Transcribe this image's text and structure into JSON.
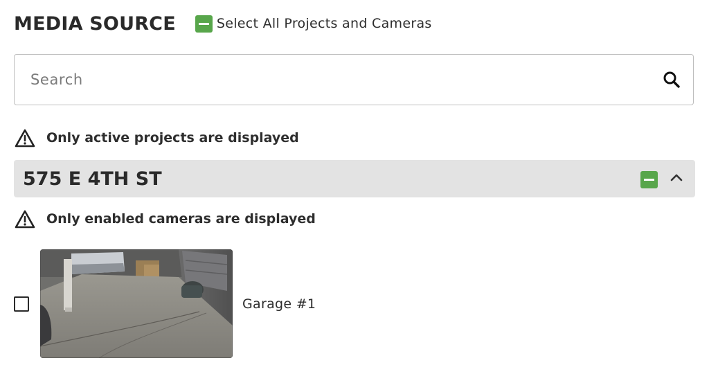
{
  "header": {
    "title": "MEDIA SOURCE",
    "select_all_label": "Select All Projects and Cameras"
  },
  "search": {
    "placeholder": "Search",
    "value": ""
  },
  "notices": {
    "projects": "Only active projects are displayed",
    "cameras": "Only enabled cameras are displayed"
  },
  "project": {
    "name": "575 E 4TH ST"
  },
  "cameras": [
    {
      "label": "Garage #1"
    }
  ],
  "colors": {
    "accent_green": "#58a64b",
    "project_bar": "#e3e3e3",
    "border": "#bdbdbd"
  },
  "icons": {
    "search": "search-icon",
    "warning": "warning-icon",
    "chevron": "chevron-up-icon",
    "select_all": "indeterminate-checkbox-icon"
  }
}
